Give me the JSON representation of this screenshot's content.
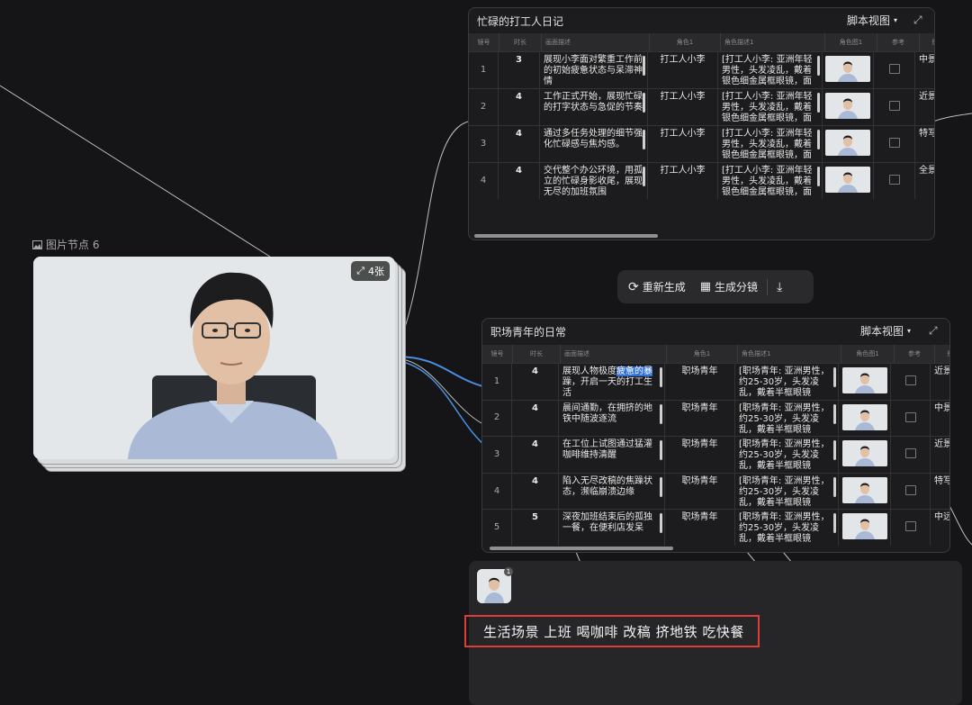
{
  "image_node": {
    "label": "图片节点 6",
    "count_badge": "4张"
  },
  "panel_top": {
    "title": "忙碌的打工人日记",
    "view_label": "脚本视图",
    "columns": [
      "镜号",
      "时长",
      "画面描述",
      "角色1",
      "角色描述1",
      "角色图1",
      "参考",
      "景别"
    ],
    "rows": [
      {
        "idx": "1",
        "dur": "3",
        "desc": "展现小李面对繁重工作前的初始疲惫状态与呆滞神情",
        "role": "打工人小李",
        "role_desc": "[打工人小李: 亚洲年轻男性，头发凌乱，戴着银色细金属框眼镜，面",
        "shot": "中景"
      },
      {
        "idx": "2",
        "dur": "4",
        "desc": "工作正式开始，展现忙碌的打字状态与急促的节奏",
        "role": "打工人小李",
        "role_desc": "[打工人小李: 亚洲年轻男性，头发凌乱，戴着银色细金属框眼镜，面",
        "shot": "近景"
      },
      {
        "idx": "3",
        "dur": "4",
        "desc": "通过多任务处理的细节强化忙碌感与焦灼感。",
        "role": "打工人小李",
        "role_desc": "[打工人小李: 亚洲年轻男性，头发凌乱，戴着银色细金属框眼镜，面",
        "shot": "特写"
      },
      {
        "idx": "4",
        "dur": "4",
        "desc": "交代整个办公环境，用孤立的忙碌身影收尾，展现无尽的加班氛围",
        "role": "打工人小李",
        "role_desc": "[打工人小李: 亚洲年轻男性，头发凌乱，戴着银色细金属框眼镜，面",
        "shot": "全景"
      }
    ]
  },
  "toolbar": {
    "regenerate": "重新生成",
    "storyboard": "生成分镜"
  },
  "panel_bottom": {
    "title": "职场青年的日常",
    "view_label": "脚本视图",
    "columns": [
      "镜号",
      "时长",
      "画面描述",
      "角色1",
      "角色描述1",
      "角色图1",
      "参考",
      "景别"
    ],
    "rows": [
      {
        "idx": "1",
        "dur": "4",
        "desc_pre": "展现人物极度",
        "desc_hl": "疲惫的暴",
        "desc_post": "躁，开启一天的打工生活",
        "role": "职场青年",
        "role_desc": "[职场青年: 亚洲男性，约25-30岁，头发凌乱，戴着半框眼镜",
        "shot": "近景"
      },
      {
        "idx": "2",
        "dur": "4",
        "desc": "晨间通勤，在拥挤的地铁中随波逐流",
        "role": "职场青年",
        "role_desc": "[职场青年: 亚洲男性，约25-30岁，头发凌乱，戴着半框眼镜",
        "shot": "中景"
      },
      {
        "idx": "3",
        "dur": "4",
        "desc": "在工位上试图通过猛灌咖啡维持清醒",
        "role": "职场青年",
        "role_desc": "[职场青年: 亚洲男性，约25-30岁，头发凌乱，戴着半框眼镜",
        "shot": "近景"
      },
      {
        "idx": "4",
        "dur": "4",
        "desc": "陷入无尽改稿的焦躁状态，濒临崩溃边缘",
        "role": "职场青年",
        "role_desc": "[职场青年: 亚洲男性，约25-30岁，头发凌乱，戴着半框眼镜",
        "shot": "特写"
      },
      {
        "idx": "5",
        "dur": "5",
        "desc": "深夜加班结束后的孤独一餐，在便利店发呆",
        "role": "职场青年",
        "role_desc": "[职场青年: 亚洲男性，约25-30岁，头发凌乱，戴着半框眼镜",
        "shot": "中远"
      }
    ]
  },
  "prompt": {
    "avatar_badge": "1",
    "text": "生活场景 上班  喝咖啡  改稿  挤地铁  吃快餐"
  },
  "colors": {
    "background": "#151517",
    "panel": "#1c1c1e",
    "highlight_box": "#e23b3b",
    "selection": "#2f6fd6"
  }
}
